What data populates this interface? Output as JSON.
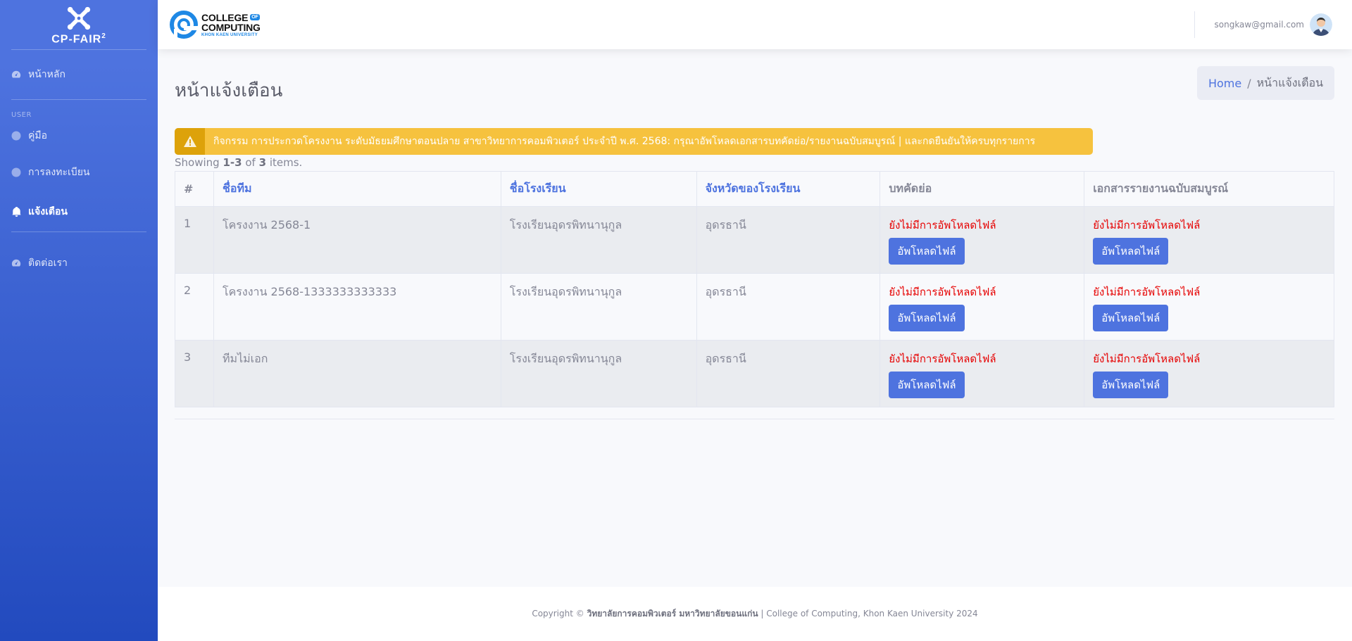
{
  "sidebar": {
    "brand": {
      "name": "CP-FAIR",
      "superscript": "2"
    },
    "nav_home": "หน้าหลัก",
    "section_heading": "USER",
    "nav_manual": "คู่มือ",
    "nav_register": "การลงทะเบียน",
    "nav_notifications": "แจ้งเตือน",
    "nav_contact": "ติดต่อเรา"
  },
  "topbar": {
    "logo": {
      "line1": "COLLEGE",
      "of": "OF",
      "line2": "COMPUTING",
      "line3": "KHON KAEN UNIVERSITY"
    },
    "user_email": "songkaw@gmail.com"
  },
  "page": {
    "title": "หน้าแจ้งเตือน",
    "breadcrumb": {
      "home": "Home",
      "separator": "/",
      "current": "หน้าแจ้งเตือน"
    }
  },
  "alert": {
    "text": "กิจกรรม การประกวดโครงงาน ระดับมัธยมศึกษาตอนปลาย สาขาวิทยาการคอมพิวเตอร์ ประจำปี พ.ศ. 2568: กรุณาอัพโหลดเอกสารบทคัดย่อ/รายงานฉบับสมบูรณ์ | และกดยืนยันให้ครบทุกรายการ"
  },
  "summary": {
    "prefix": "Showing",
    "range": "1-3",
    "of": "of",
    "total": "3",
    "suffix": "items."
  },
  "table": {
    "headers": {
      "index": "#",
      "team": "ชื่อทีม",
      "school": "ชื่อโรงเรียน",
      "province": "จังหวัดของโรงเรียน",
      "abstract": "บทคัดย่อ",
      "report": "เอกสารรายงานฉบับสมบูรณ์"
    },
    "rows": [
      {
        "index": "1",
        "team": "โครงงาน 2568-1",
        "school": "โรงเรียนอุดรพิทนานุกูล",
        "province": "อุดรธานี",
        "abstract_status": "ยังไม่มีการอัพโหลดไฟล์",
        "abstract_button": "อัพโหลดไฟล์",
        "report_status": "ยังไม่มีการอัพโหลดไฟล์",
        "report_button": "อัพโหลดไฟล์"
      },
      {
        "index": "2",
        "team": "โครงงาน 2568-1333333333333",
        "school": "โรงเรียนอุดรพิทนานุกูล",
        "province": "อุดรธานี",
        "abstract_status": "ยังไม่มีการอัพโหลดไฟล์",
        "abstract_button": "อัพโหลดไฟล์",
        "report_status": "ยังไม่มีการอัพโหลดไฟล์",
        "report_button": "อัพโหลดไฟล์"
      },
      {
        "index": "3",
        "team": "ทีมไม่เอก",
        "school": "โรงเรียนอุดรพิทนานุกูล",
        "province": "อุดรธานี",
        "abstract_status": "ยังไม่มีการอัพโหลดไฟล์",
        "abstract_button": "อัพโหลดไฟล์",
        "report_status": "ยังไม่มีการอัพโหลดไฟล์",
        "report_button": "อัพโหลดไฟล์"
      }
    ]
  },
  "footer": {
    "prefix": "Copyright ©",
    "org_thai": "วิทยาลัยการคอมพิวเตอร์ มหาวิทยาลัยขอนแก่น",
    "rest": "| College of Computing, Khon Kaen University 2024"
  },
  "colors": {
    "sidebar_start": "#4e73df",
    "sidebar_end": "#224abe",
    "primary": "#4e73df",
    "warning": "#f6c23e",
    "danger_text": "#e60000"
  }
}
